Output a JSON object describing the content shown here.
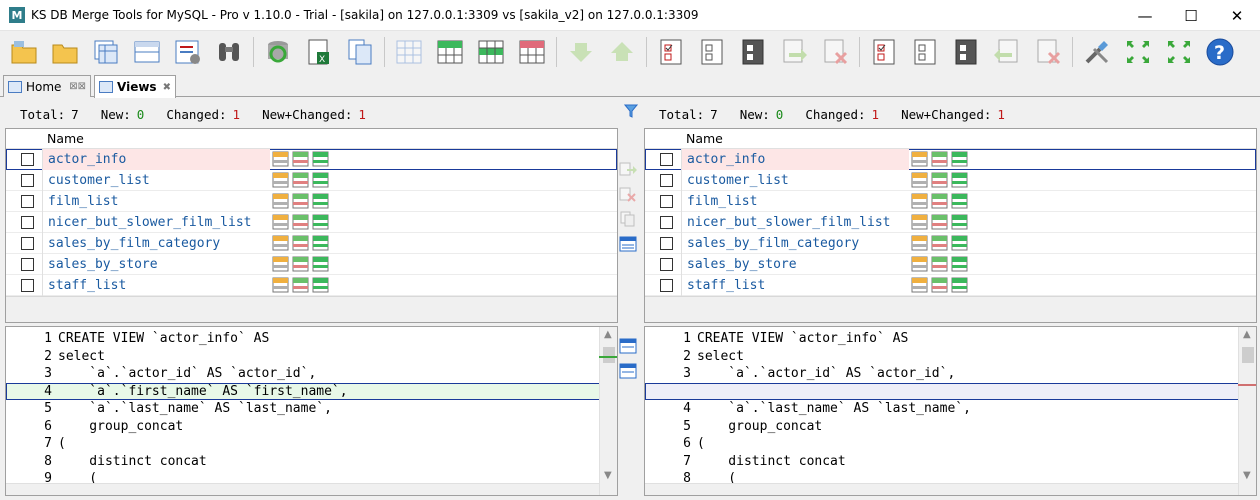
{
  "window": {
    "title": "KS DB Merge Tools for MySQL - Pro v 1.10.0 - Trial - [sakila] on 127.0.0.1:3309 vs [sakila_v2] on 127.0.0.1:3309",
    "app_icon_letter": "M",
    "minimize": "—",
    "maximize": "☐",
    "close": "✕"
  },
  "tabs": [
    {
      "label": "Home"
    },
    {
      "label": "Views",
      "close": "✖"
    }
  ],
  "summary": {
    "total_label": "Total:",
    "total": "7",
    "new_label": "New:",
    "new": "0",
    "changed_label": "Changed:",
    "changed": "1",
    "newchanged_label": "New+Changed:",
    "newchanged": "1"
  },
  "grid": {
    "header": "Name",
    "rows": [
      {
        "name": "actor_info"
      },
      {
        "name": "customer_list"
      },
      {
        "name": "film_list"
      },
      {
        "name": "nicer_but_slower_film_list"
      },
      {
        "name": "sales_by_film_category"
      },
      {
        "name": "sales_by_store"
      },
      {
        "name": "staff_list"
      }
    ]
  },
  "code_left": [
    {
      "n": "1",
      "t": "CREATE VIEW `actor_info` AS"
    },
    {
      "n": "2",
      "t": "select"
    },
    {
      "n": "3",
      "t": "    `a`.`actor_id` AS `actor_id`,"
    },
    {
      "n": "4",
      "t": "    `a`.`first_name` AS `first_name`,"
    },
    {
      "n": "5",
      "t": "    `a`.`last_name` AS `last_name`,"
    },
    {
      "n": "6",
      "t": "    group_concat"
    },
    {
      "n": "7",
      "t": "("
    },
    {
      "n": "8",
      "t": "    distinct concat"
    },
    {
      "n": "9",
      "t": "    ("
    }
  ],
  "code_right": [
    {
      "n": "1",
      "t": "CREATE VIEW `actor_info` AS"
    },
    {
      "n": "2",
      "t": "select"
    },
    {
      "n": "3",
      "t": "    `a`.`actor_id` AS `actor_id`,"
    },
    {
      "n": "",
      "t": ""
    },
    {
      "n": "4",
      "t": "    `a`.`last_name` AS `last_name`,"
    },
    {
      "n": "5",
      "t": "    group_concat"
    },
    {
      "n": "6",
      "t": "("
    },
    {
      "n": "7",
      "t": "    distinct concat"
    },
    {
      "n": "8",
      "t": "    ("
    }
  ],
  "colors": {
    "changed_row": "#fde6e6",
    "added_line": "#e8f8e8",
    "link_blue": "#1a5aa0",
    "count_green": "#1a8a1a",
    "count_red": "#c01818"
  }
}
